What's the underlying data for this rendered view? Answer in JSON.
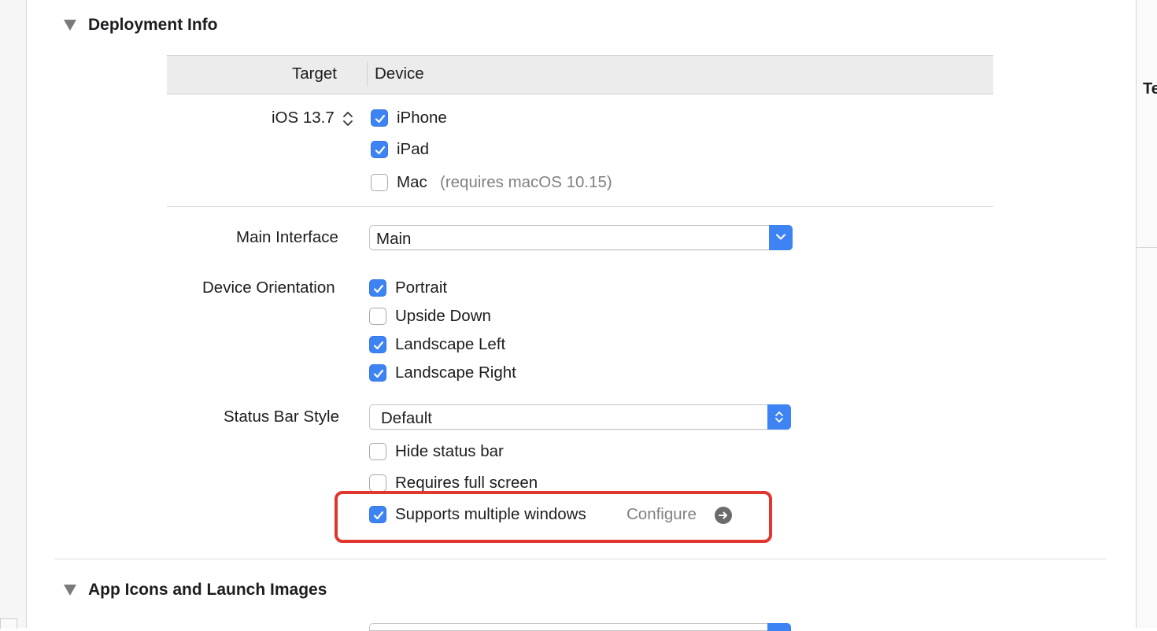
{
  "deployment": {
    "title": "Deployment Info",
    "headers": {
      "target": "Target",
      "device": "Device"
    },
    "target_version": "iOS 13.7",
    "devices": [
      {
        "label": "iPhone",
        "checked": true
      },
      {
        "label": "iPad",
        "checked": true
      },
      {
        "label": "Mac",
        "checked": false,
        "note": "(requires macOS 10.15)"
      }
    ],
    "main_interface": {
      "label": "Main Interface",
      "value": "Main"
    },
    "orientation": {
      "label": "Device Orientation",
      "options": [
        {
          "label": "Portrait",
          "checked": true
        },
        {
          "label": "Upside Down",
          "checked": false
        },
        {
          "label": "Landscape Left",
          "checked": true
        },
        {
          "label": "Landscape Right",
          "checked": true
        }
      ]
    },
    "status_bar": {
      "label": "Status Bar Style",
      "value": "Default",
      "hide_label": "Hide status bar",
      "hide_checked": false,
      "full_screen_label": "Requires full screen",
      "full_screen_checked": false,
      "multi_window_label": "Supports multiple windows",
      "multi_window_checked": true,
      "configure_label": "Configure"
    }
  },
  "app_icons": {
    "title": "App Icons and Launch Images"
  },
  "inspector": {
    "partial_label": "Te"
  },
  "colors": {
    "accent": "#3d83f4",
    "highlight": "#e0362f"
  },
  "icons": {
    "disclosure": "triangle-down-icon",
    "stepper": "stepper-updown-icon",
    "popup": "chevron-down-icon",
    "configure": "arrow-right-circle-icon"
  }
}
